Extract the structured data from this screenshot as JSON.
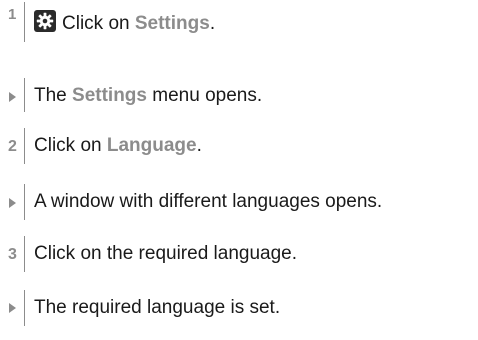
{
  "steps": [
    {
      "kind": "step",
      "number": "1",
      "icon": "gear-icon",
      "prefix": "Click on ",
      "highlight": "Settings",
      "suffix": "."
    },
    {
      "kind": "result",
      "prefix": "The ",
      "highlight": "Settings",
      "suffix": " menu opens."
    },
    {
      "kind": "step",
      "number": "2",
      "prefix": "Click on ",
      "highlight": "Language",
      "suffix": "."
    },
    {
      "kind": "result",
      "text": "A window with different languages opens."
    },
    {
      "kind": "step",
      "number": "3",
      "text": "Click on the required language."
    },
    {
      "kind": "result",
      "text": "The required language is set."
    }
  ],
  "colors": {
    "highlight": "#8c8c8c",
    "text": "#1a1a1a",
    "icon_bg": "#2b2b2b"
  }
}
